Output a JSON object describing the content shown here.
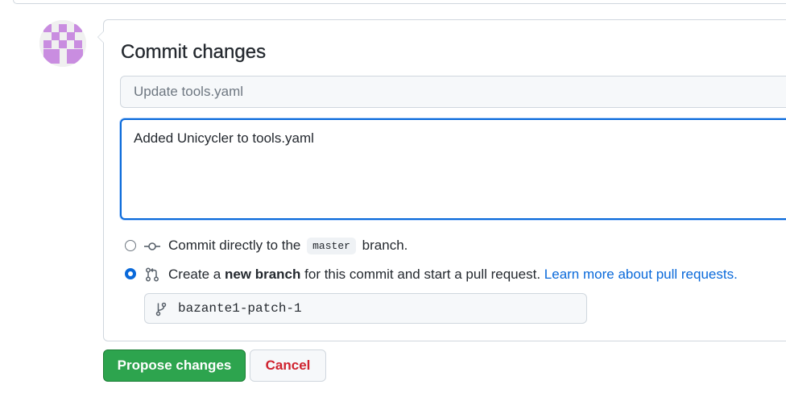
{
  "commit_form": {
    "title": "Commit changes",
    "summary_placeholder": "Update tools.yaml",
    "description_value": "Added Unicycler to tools.yaml",
    "options": {
      "direct": {
        "prefix": "Commit directly to the",
        "branch_code": "master",
        "suffix": "branch.",
        "selected": false,
        "icon": "git-commit-icon"
      },
      "new_branch": {
        "prefix": "Create a",
        "bold": "new branch",
        "suffix": "for this commit and start a pull request.",
        "link": "Learn more about pull requests.",
        "selected": true,
        "icon": "git-pull-request-icon"
      }
    },
    "branch_name": "bazante1-patch-1",
    "branch_icon": "git-branch-icon"
  },
  "buttons": {
    "propose": "Propose changes",
    "cancel": "Cancel"
  },
  "colors": {
    "primary_green": "#2da44e",
    "focus_blue": "#0969da",
    "link_blue": "#0969da",
    "danger_red": "#cf222e",
    "avatar_purple": "#c98de0"
  }
}
